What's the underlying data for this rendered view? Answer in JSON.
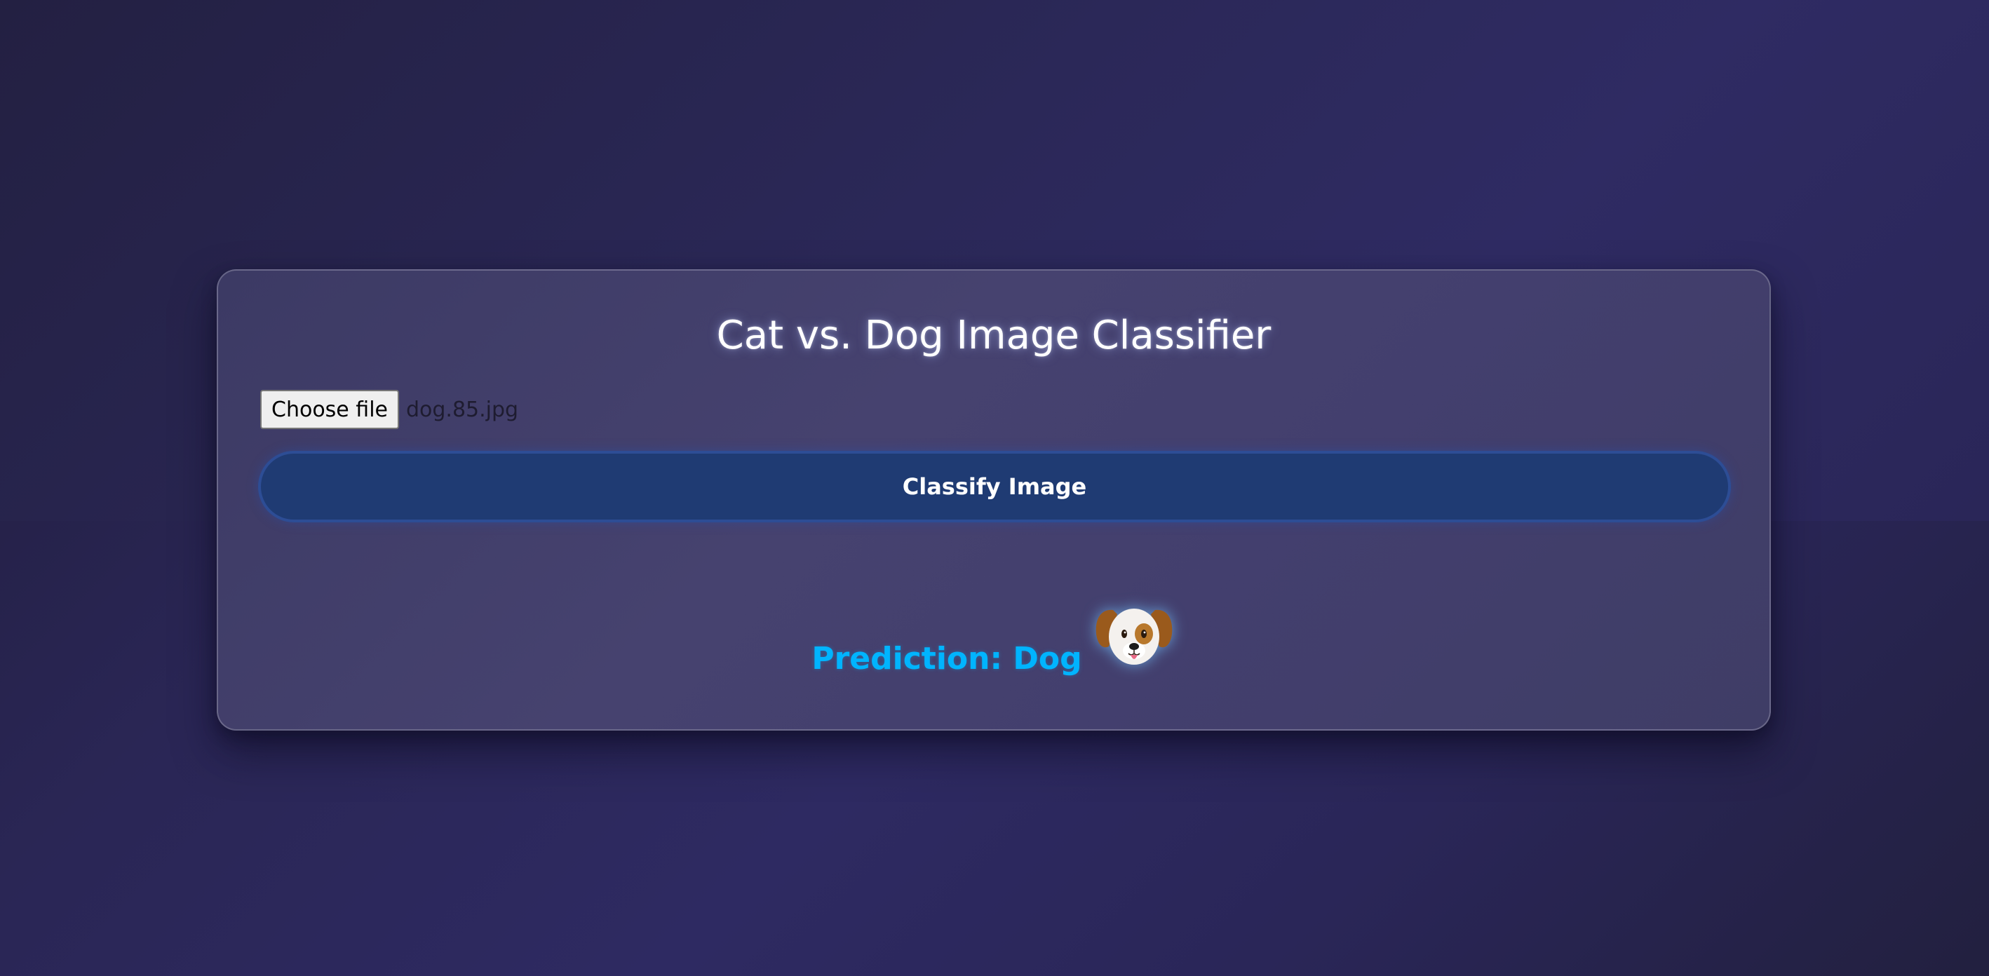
{
  "app": {
    "title": "Cat vs. Dog Image Classifier"
  },
  "upload": {
    "button_label": "Choose file",
    "file_name": "dog.85.jpg"
  },
  "actions": {
    "classify_label": "Classify Image"
  },
  "result": {
    "text": "Prediction: Dog",
    "icon": "dog-face-icon"
  },
  "colors": {
    "prediction_accent": "#00b4ff",
    "button_bg": "#1f3b73",
    "card_bg": "#433f6e"
  }
}
